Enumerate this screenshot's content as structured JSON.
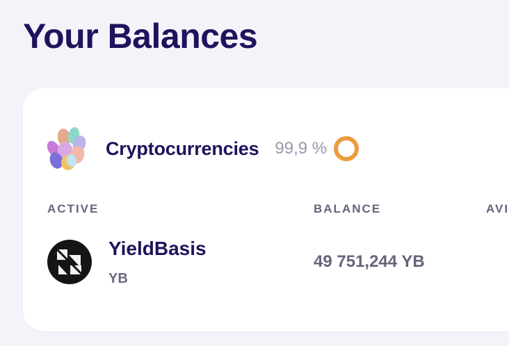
{
  "page": {
    "title": "Your Balances"
  },
  "group": {
    "title": "Cryptocurrencies",
    "icon": "crypto-coins-icon",
    "share_text": "99,9 %",
    "share_value": 0.999,
    "share_color": "#ec9c3c"
  },
  "table": {
    "columns": [
      "ACTIVE",
      "BALANCE",
      "AVI"
    ],
    "rows": [
      {
        "name": "YieldBasis",
        "symbol": "YB",
        "balance": "49 751,244 YB",
        "icon": "yieldbasis-logo-icon"
      }
    ]
  },
  "colors": {
    "background": "#f4f3f9",
    "card": "#ffffff",
    "title": "#21125c",
    "muted": "#67647a",
    "accent_ring": "#ec9c3c"
  }
}
